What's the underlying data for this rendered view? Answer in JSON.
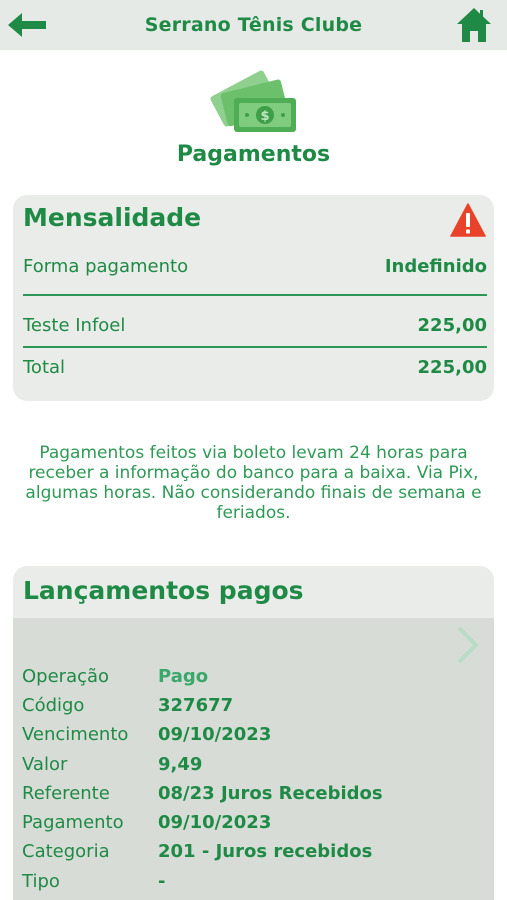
{
  "header": {
    "title": "Serrano Tênis Clube"
  },
  "icons": {
    "back": "arrow-left-icon",
    "home": "home-icon",
    "hero": "money-bills-icon",
    "warning": "warning-triangle-icon",
    "next": "chevron-right-icon"
  },
  "page": {
    "title": "Pagamentos"
  },
  "mensalidade": {
    "title": "Mensalidade",
    "rows": [
      {
        "label": "Forma pagamento",
        "value": "Indefinido"
      },
      {
        "label": "Teste Infoel",
        "value": "225,00"
      },
      {
        "label": "Total",
        "value": "225,00"
      }
    ]
  },
  "notice": "Pagamentos feitos via boleto levam 24 horas para receber a informação do banco para a baixa. Via Pix, algumas horas. Não considerando finais de semana e feriados.",
  "lancamentos": {
    "title": "Lançamentos pagos",
    "fields": [
      {
        "label": "Operação",
        "value": "Pago"
      },
      {
        "label": "Código",
        "value": "327677"
      },
      {
        "label": "Vencimento",
        "value": "09/10/2023"
      },
      {
        "label": "Valor",
        "value": "9,49"
      },
      {
        "label": "Referente",
        "value": "08/23 Juros Recebidos"
      },
      {
        "label": "Pagamento",
        "value": "09/10/2023"
      },
      {
        "label": "Categoria",
        "value": "201 - Juros recebidos"
      },
      {
        "label": "Tipo",
        "value": "-"
      }
    ]
  },
  "colors": {
    "primary": "#1f8a45",
    "card": "#e9ece9",
    "warning": "#e8432a"
  }
}
